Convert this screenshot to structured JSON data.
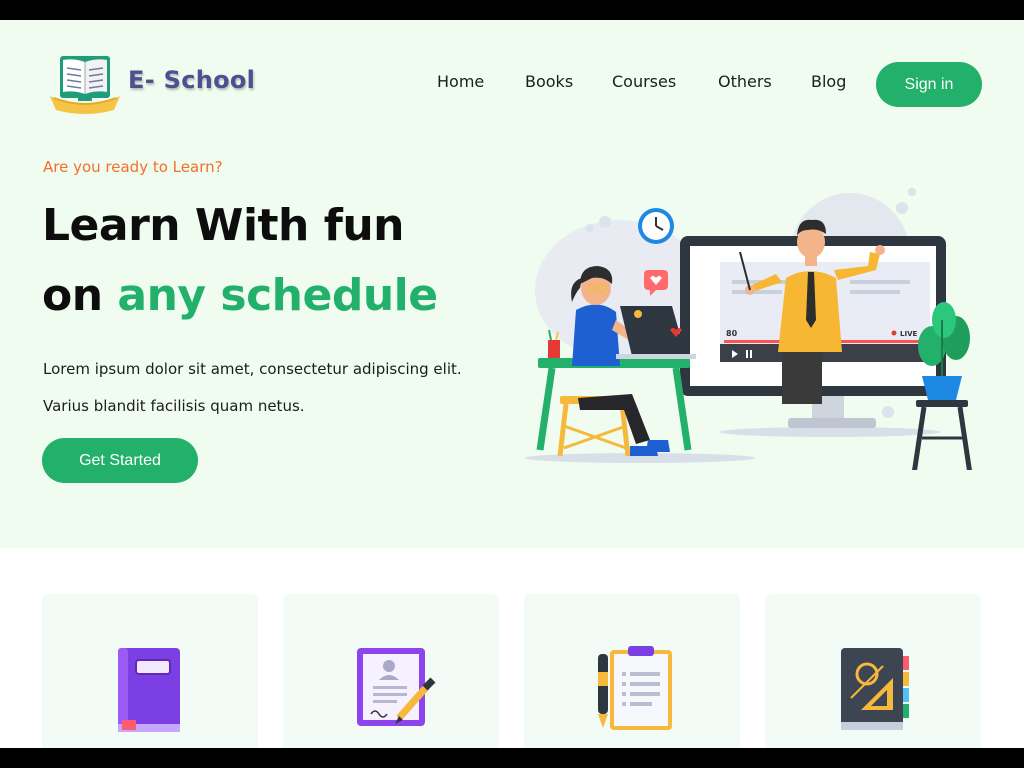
{
  "brand": {
    "name": "E- School"
  },
  "nav": {
    "items": [
      {
        "label": "Home"
      },
      {
        "label": "Books"
      },
      {
        "label": "Courses"
      },
      {
        "label": "Others"
      },
      {
        "label": "Blog"
      }
    ],
    "signin_label": "Sign in"
  },
  "hero": {
    "eyebrow": "Are you ready to Learn?",
    "headline_line1": "Learn With fun",
    "headline_line2_prefix": "on ",
    "headline_line2_accent": "any schedule",
    "paragraph_line1": "Lorem ipsum dolor sit amet, consectetur adipiscing elit.",
    "paragraph_line2": "Varius blandit facilisis quam netus.",
    "cta_label": "Get Started",
    "video_overlay": {
      "viewers": "80",
      "live_label": "LIVE"
    }
  },
  "features": {
    "cards": [
      {
        "icon": "book-icon"
      },
      {
        "icon": "certificate-icon"
      },
      {
        "icon": "clipboard-icon"
      },
      {
        "icon": "notebook-icon"
      }
    ]
  },
  "colors": {
    "accent": "#22b06a",
    "hero_bg": "#effcef",
    "eyebrow": "#f36f2a",
    "brand_text": "#4a5090"
  }
}
